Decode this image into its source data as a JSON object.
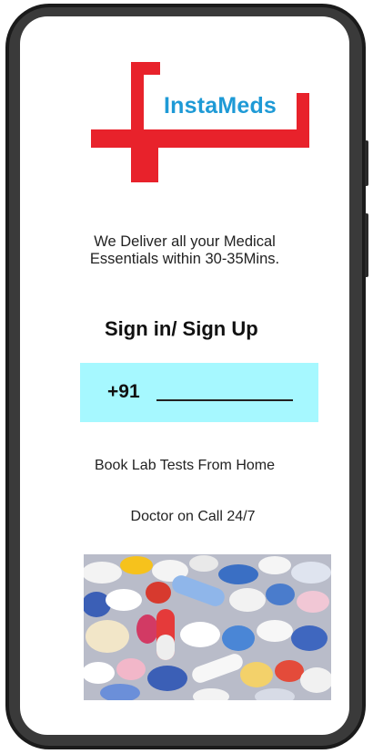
{
  "app": {
    "brand_name": "InstaMeds",
    "brand_colors": {
      "cross": "#e8222b",
      "text": "#1e9ad6",
      "phone_box": "#a6f8ff"
    }
  },
  "tagline": {
    "line1": "We Deliver all your Medical",
    "line2": "Essentials within 30-35Mins."
  },
  "signin": {
    "title": "Sign in/ Sign Up",
    "country_code": "+91",
    "phone_value": ""
  },
  "features": {
    "lab_tests": "Book Lab Tests From Home",
    "doctor_call": "Doctor on Call 24/7"
  },
  "image": {
    "semantic": "medicine-pills-photo"
  }
}
